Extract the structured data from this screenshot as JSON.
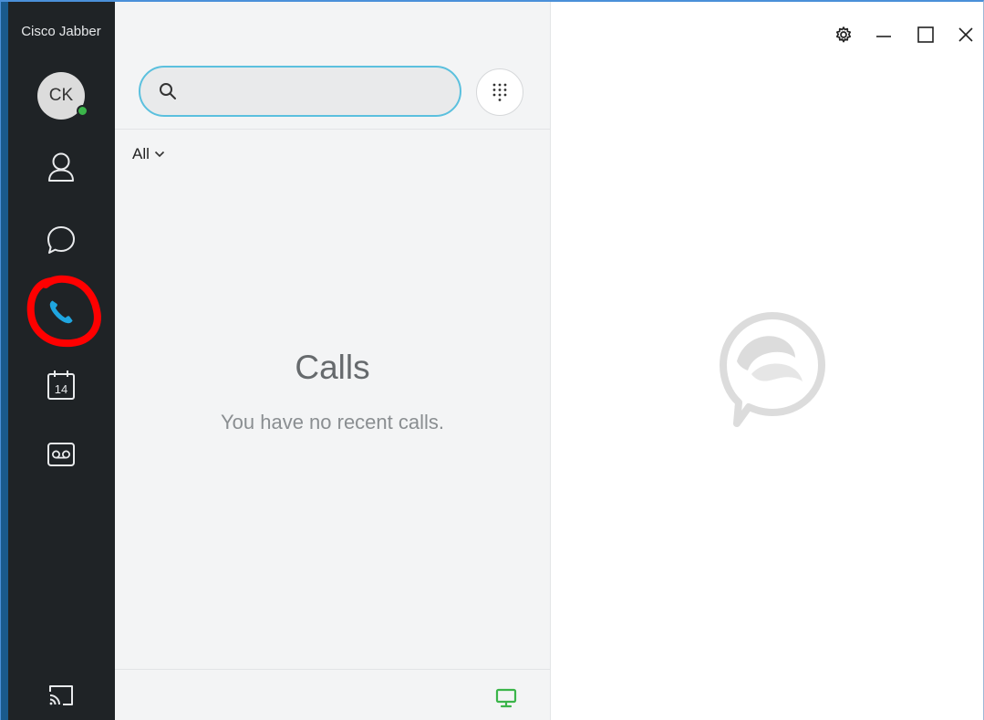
{
  "app": {
    "title": "Cisco Jabber"
  },
  "user": {
    "initials": "CK",
    "presence_color": "#3bb54a"
  },
  "nav": {
    "items": [
      {
        "id": "contacts",
        "icon": "person-icon"
      },
      {
        "id": "chats",
        "icon": "chat-bubble-icon"
      },
      {
        "id": "calls",
        "icon": "phone-icon",
        "active": true,
        "accent": "#1fa6e0"
      },
      {
        "id": "meetings",
        "icon": "calendar-icon",
        "calendar_day": "14"
      },
      {
        "id": "voicemail",
        "icon": "voicemail-icon"
      }
    ],
    "bottom": {
      "icon": "cast-screen-icon"
    }
  },
  "search": {
    "value": "",
    "placeholder": ""
  },
  "filter": {
    "selected": "All"
  },
  "calls": {
    "empty_title": "Calls",
    "empty_message": "You have no recent calls."
  },
  "footer": {
    "device_icon": "computer-monitor-icon",
    "device_color": "#3bb54a"
  },
  "window_controls": {
    "icons": [
      "gear-icon",
      "minimize-icon",
      "maximize-icon",
      "close-icon"
    ]
  },
  "colors": {
    "rail_bg": "#1f2326",
    "accent_blue": "#1fa6e0",
    "search_border": "#5bc0de",
    "highlight_ring": "#ff0000"
  }
}
